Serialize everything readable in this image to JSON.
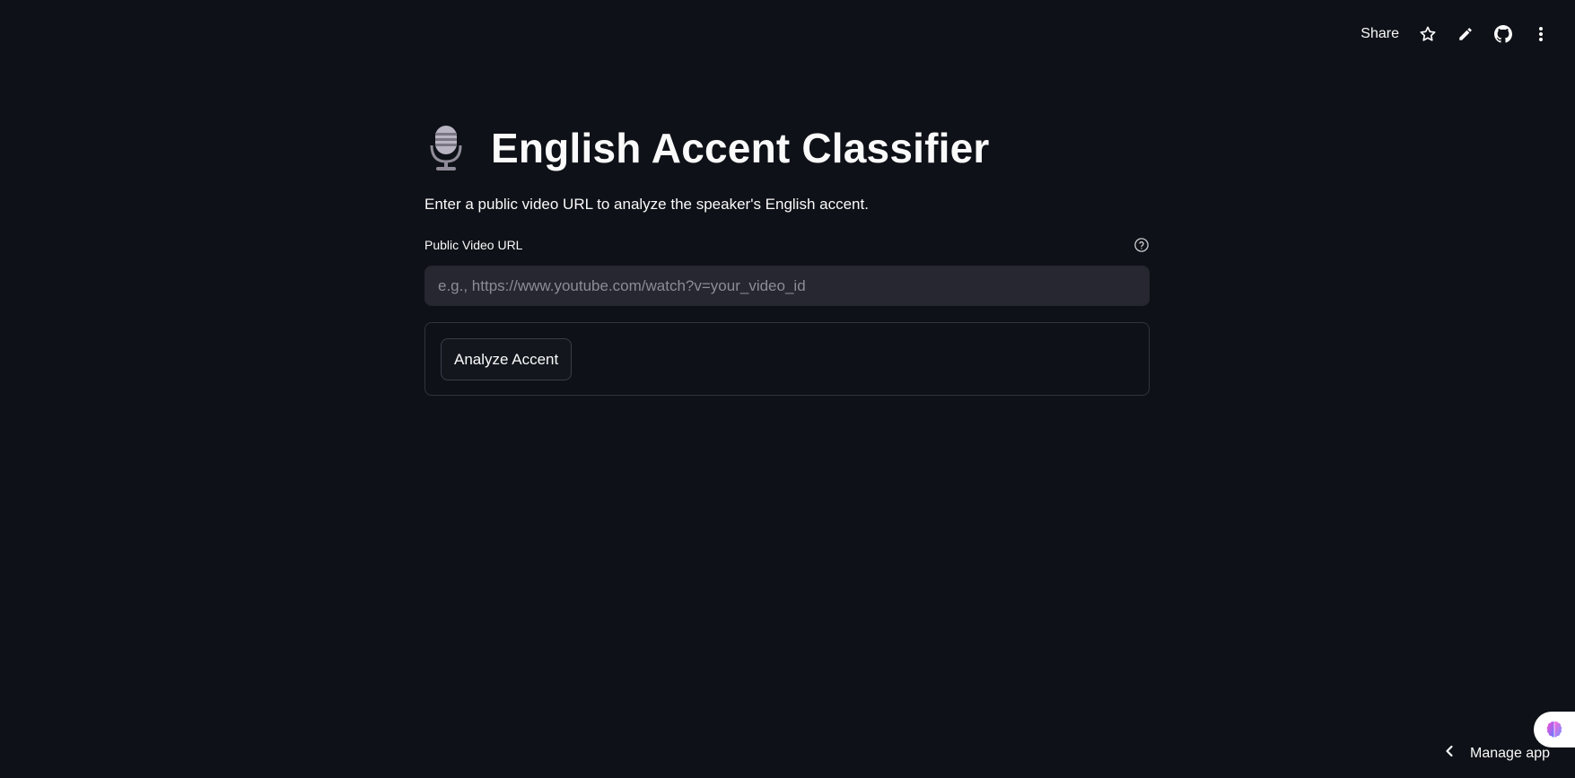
{
  "toolbar": {
    "share_label": "Share",
    "icons": [
      "star-icon",
      "pencil-icon",
      "github-icon",
      "more-vertical-icon"
    ]
  },
  "header": {
    "icon": "microphone-icon",
    "title": "English Accent Classifier"
  },
  "main": {
    "description": "Enter a public video URL to analyze the speaker's English accent.",
    "url_field": {
      "label": "Public Video URL",
      "value": "",
      "placeholder": "e.g., https://www.youtube.com/watch?v=your_video_id"
    },
    "analyze_button_label": "Analyze Accent"
  },
  "footer": {
    "manage_label": "Manage app"
  },
  "colors": {
    "background": "#0e1117",
    "input_bg": "#262730",
    "text": "#fafafa",
    "border": "#31333f"
  }
}
